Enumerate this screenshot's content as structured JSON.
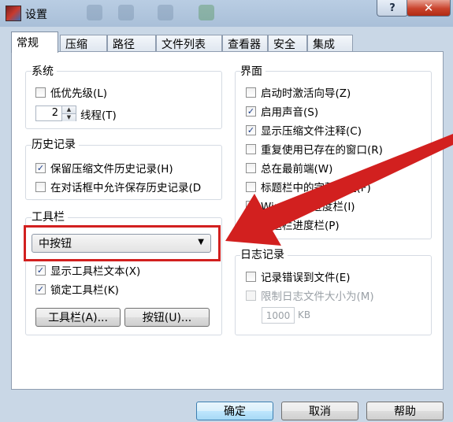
{
  "window": {
    "title": "设置",
    "help_label": "?",
    "close_label": "✕"
  },
  "tabs": [
    "常规",
    "压缩",
    "路径",
    "文件列表",
    "查看器",
    "安全",
    "集成"
  ],
  "system": {
    "title": "系统",
    "low_priority": {
      "label": "低优先级(L)",
      "checked": false
    },
    "threads_value": "2",
    "threads_label": "线程(T)"
  },
  "history": {
    "title": "历史记录",
    "keep_history": {
      "label": "保留压缩文件历史记录(H)",
      "checked": true
    },
    "allow_dialog_history": {
      "label": "在对话框中允许保存历史记录(D",
      "checked": false
    }
  },
  "toolbar": {
    "title": "工具栏",
    "button_size_selected": "中按钮",
    "show_text": {
      "label": "显示工具栏文本(X)",
      "checked": true
    },
    "lock": {
      "label": "锁定工具栏(K)",
      "checked": true
    },
    "toolbar_button": "工具栏(A)...",
    "buttons_button": "按钮(U)..."
  },
  "interface": {
    "title": "界面",
    "items": [
      {
        "label": "启动时激活向导(Z)",
        "checked": false
      },
      {
        "label": "启用声音(S)",
        "checked": true
      },
      {
        "label": "显示压缩文件注释(C)",
        "checked": true
      },
      {
        "label": "重复使用已存在的窗口(R)",
        "checked": false
      },
      {
        "label": "总在最前端(W)",
        "checked": false
      },
      {
        "label": "标题栏中的完整路径(F)",
        "checked": false
      },
      {
        "label": "Windows 进度栏(I)",
        "checked": true
      },
      {
        "label": "标题栏进度栏(P)",
        "checked": false
      }
    ]
  },
  "log": {
    "title": "日志记录",
    "log_errors": {
      "label": "记录错误到文件(E)",
      "checked": false
    },
    "limit_size": {
      "label": "限制日志文件大小为(M)",
      "checked": false
    },
    "size_value": "1000",
    "size_unit": "KB"
  },
  "footer": {
    "ok": "确定",
    "cancel": "取消",
    "help": "帮助"
  },
  "annotation": {
    "arrow_color": "#d2201f"
  }
}
